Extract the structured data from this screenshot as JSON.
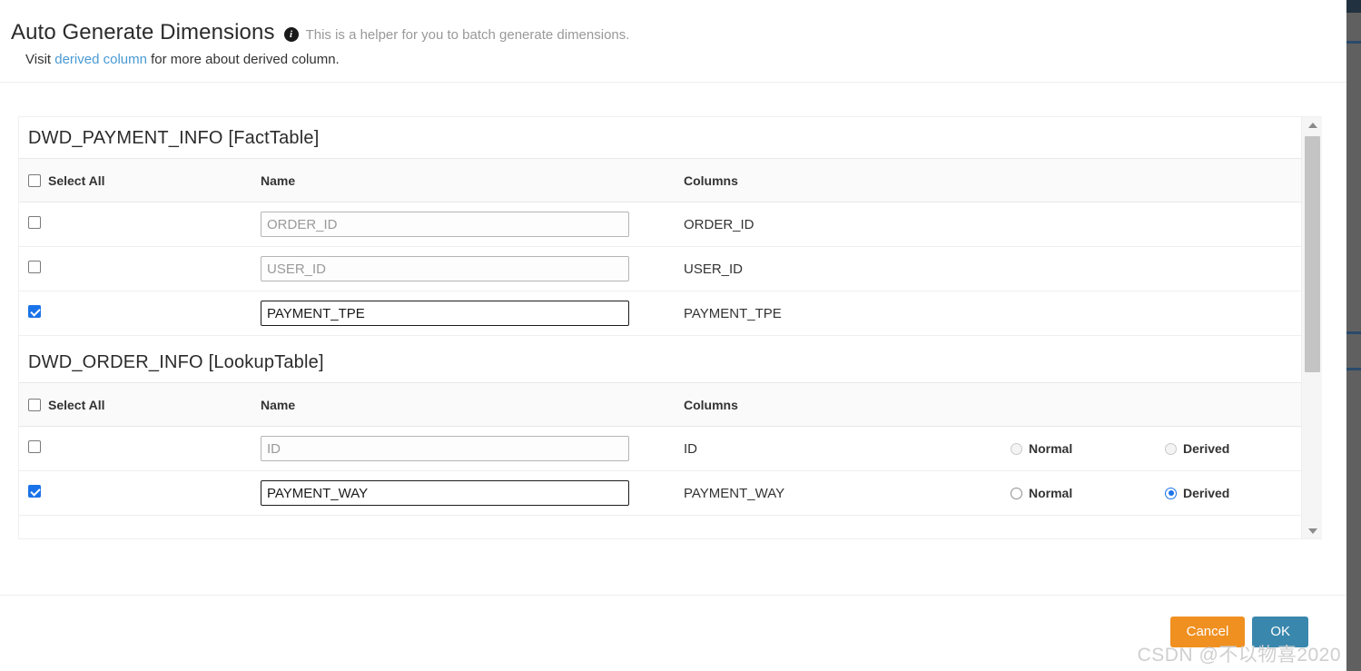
{
  "header": {
    "title": "Auto Generate Dimensions",
    "info_icon": "info-circle-icon",
    "hint": "This is a helper for you to batch generate dimensions.",
    "sub_prefix": "Visit ",
    "sub_link": "derived column",
    "sub_suffix": " for more about derived column."
  },
  "tables": [
    {
      "title": "DWD_PAYMENT_INFO [FactTable]",
      "headers": {
        "select_all": "Select All",
        "name": "Name",
        "columns": "Columns"
      },
      "has_type_column": false,
      "rows": [
        {
          "checked": false,
          "name_value": "",
          "name_placeholder": "ORDER_ID",
          "input_state": "disabled",
          "column": "ORDER_ID",
          "highlight": "none"
        },
        {
          "checked": false,
          "name_value": "",
          "name_placeholder": "USER_ID",
          "input_state": "disabled",
          "column": "USER_ID",
          "highlight": "selected"
        },
        {
          "checked": true,
          "name_value": "PAYMENT_TPE",
          "name_placeholder": "",
          "input_state": "active",
          "column": "PAYMENT_TPE",
          "highlight": "none"
        }
      ]
    },
    {
      "title": "DWD_ORDER_INFO [LookupTable]",
      "headers": {
        "select_all": "Select All",
        "name": "Name",
        "columns": "Columns"
      },
      "has_type_column": true,
      "rows": [
        {
          "checked": false,
          "name_value": "",
          "name_placeholder": "ID",
          "input_state": "disabled",
          "column": "ID",
          "highlight": "none",
          "normal_label": "Normal",
          "derived_label": "Derived",
          "type_selected": "none",
          "radios_dim": true
        },
        {
          "checked": true,
          "name_value": "PAYMENT_WAY",
          "name_placeholder": "",
          "input_state": "active",
          "column": "PAYMENT_WAY",
          "highlight": "shaded",
          "normal_label": "Normal",
          "derived_label": "Derived",
          "type_selected": "derived",
          "radios_dim": false
        }
      ]
    }
  ],
  "scrollbar": {
    "up_arrow": "scroll-up-arrow-icon",
    "down_arrow": "scroll-down-arrow-icon"
  },
  "footer": {
    "cancel_label": "Cancel",
    "ok_label": "OK"
  },
  "watermark": "CSDN @不以物喜2020",
  "colors": {
    "link": "#4a9ad4",
    "row_highlight": "#aee3f9",
    "checkbox_checked": "#1a73e8",
    "radio_selected": "#1a73e8",
    "cancel_button": "#ef9021",
    "ok_button": "#3a87ad"
  }
}
